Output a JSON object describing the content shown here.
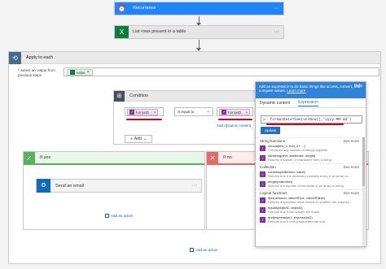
{
  "recurrence": {
    "label": "Recurrence",
    "more": "···"
  },
  "list_rows": {
    "label": "List rows present in a table",
    "more": "···"
  },
  "apply_each": {
    "label": "Apply to each",
    "select_label": "* Select an output from previous steps",
    "value_token": "value",
    "value_remove": "×"
  },
  "condition": {
    "label": "Condition",
    "more": "···",
    "left_token": "formatD...",
    "operator": "is equal to",
    "right_token": "formatD...",
    "add_dynamic": "Add dynamic content",
    "add_button": "Add",
    "token_remove": "×"
  },
  "if_yes": {
    "label": "If yes",
    "icon": "✓",
    "action_label": "Send an email",
    "action_icon": "O",
    "add_action": "Add an action"
  },
  "if_no": {
    "label": "If no",
    "icon": "✕"
  },
  "bottom": {
    "add_action": "Add an action"
  },
  "popup": {
    "description": "Add an expression to do basic things like access, convert, and compare values.",
    "learn_more": "Learn more",
    "hide": "Hide",
    "tab_dynamic": "Dynamic content",
    "tab_expression": "Expression",
    "expression": "formatDateTime(utcNow(),'yyyy-MM-dd')",
    "update": "Update",
    "sections": [
      {
        "title": "String functions",
        "see_more": "See more",
        "items": [
          {
            "name": "concat(text_1, text_2?, ...)",
            "desc": "Combines any number of strings together"
          },
          {
            "name": "substring(text, startIndex, length)",
            "desc": "Returns a subset of characters from a string."
          }
        ]
      },
      {
        "title": "Collection",
        "see_more": "See more",
        "items": [
          {
            "name": "contains(collection, value)",
            "desc": "Returns true if a dictionary contains a key, if an array co..."
          },
          {
            "name": "length(collection)",
            "desc": "Returns the number of elements in an array or string"
          }
        ]
      },
      {
        "title": "Logical functions",
        "see_more": "See more",
        "items": [
          {
            "name": "if(expression, valueIfTrue, valueIfFalse)",
            "desc": "Returns a specified value based on whether the express..."
          },
          {
            "name": "equals(object1, object2)",
            "desc": "Returns true if two values are equal."
          },
          {
            "name": "and(expression1, expression2)",
            "desc": "Returns true if both parameters are true."
          }
        ]
      }
    ]
  },
  "colors": {
    "recurrence": "#1f85ff",
    "excel": "#107c41",
    "apply_each": "#486991",
    "yes": "#58b35e",
    "no": "#e86767",
    "popup_header": "#2f83d9",
    "function": "#8a2aa8",
    "annotation": "#d0021b"
  }
}
